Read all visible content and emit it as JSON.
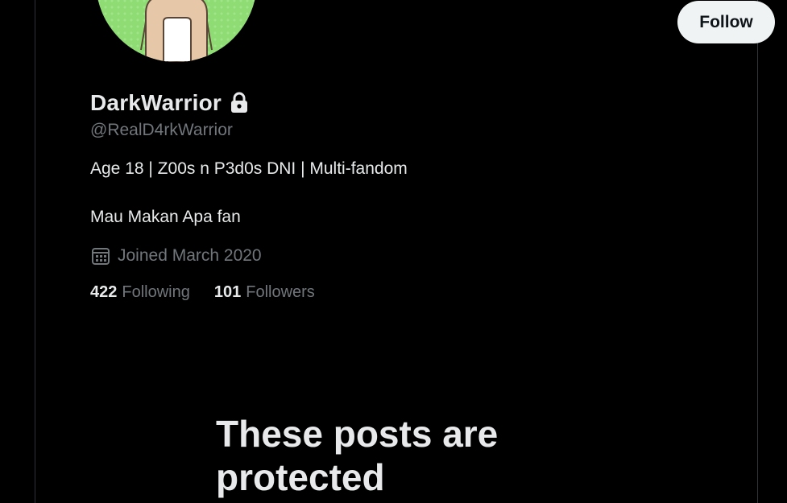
{
  "profile": {
    "display_name": "DarkWarrior",
    "handle": "@RealD4rkWarrior",
    "bio_line_1": "Age 18 | Z00s n P3d0s DNI | Multi-fandom",
    "bio_line_2": "Mau Makan Apa fan",
    "joined": "Joined March 2020",
    "avatar_bg_color": "#8fdc74",
    "locked_icon": "lock-icon"
  },
  "actions": {
    "follow_label": "Follow"
  },
  "stats": {
    "following_count": "422",
    "following_label": "Following",
    "followers_count": "101",
    "followers_label": "Followers"
  },
  "protected": {
    "title": "These posts are protected"
  },
  "colors": {
    "background": "#000000",
    "primary_text": "#e7e9ea",
    "secondary_text": "#71767b",
    "border": "#2f3336",
    "button_bg": "#eff3f4"
  }
}
